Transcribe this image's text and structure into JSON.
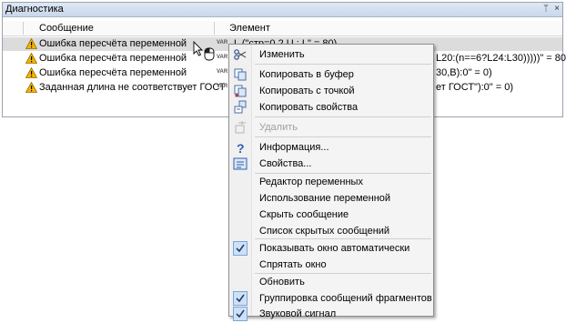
{
  "panel": {
    "title": "Диагностика",
    "pin_glyph": "ᛘ",
    "close_glyph": "×",
    "columns": {
      "message": "Сообщение",
      "element": "Элемент"
    }
  },
  "rows": [
    {
      "message": "Ошибка пересчёта переменной",
      "var_tag": "VAR",
      "element": "L (\"стр=0 2 U : L\" = 80)",
      "selected": true
    },
    {
      "message": "Ошибка пересчёта переменной",
      "var_tag": "VAR",
      "element": "L20:(n==6?L24:L30)))))\" = 80)",
      "selected": false
    },
    {
      "message": "Ошибка пересчёта переменной",
      "var_tag": "VAR",
      "element": "30,B):0\" = 0)",
      "selected": false
    },
    {
      "message": "Заданная длина не соответствует ГОСТ",
      "var_tag": "VAR",
      "element": "ет ГОСТ\"):0\" = 0)",
      "selected": false
    }
  ],
  "menu": {
    "items": [
      {
        "label": "Изменить",
        "icon": "scissors-edit-icon",
        "disabled": false
      },
      {
        "label": "Копировать в буфер",
        "icon": "copy-icon",
        "disabled": false
      },
      {
        "label": "Копировать с точкой",
        "icon": "copy-point-icon",
        "disabled": false
      },
      {
        "label": "Копировать свойства",
        "icon": "copy-properties-icon",
        "disabled": false
      },
      {
        "label": "Удалить",
        "icon": "delete-icon",
        "disabled": true
      },
      {
        "label": "Информация...",
        "icon": "question-icon",
        "disabled": false
      },
      {
        "label": "Свойства...",
        "icon": "properties-icon",
        "disabled": false
      },
      {
        "label": "Редактор переменных",
        "disabled": false
      },
      {
        "label": "Использование переменной",
        "disabled": false
      },
      {
        "label": "Скрыть сообщение",
        "disabled": false
      },
      {
        "label": "Список скрытых сообщений",
        "disabled": false
      },
      {
        "label": "Показывать окно автоматически",
        "checked": true
      },
      {
        "label": "Спрятать окно",
        "disabled": false
      },
      {
        "label": "Обновить",
        "disabled": false
      },
      {
        "label": "Группировка сообщений фрагментов",
        "checked": true
      },
      {
        "label": "Звуковой сигнал",
        "checked": true
      }
    ]
  },
  "colors": {
    "warning": "#f2b600",
    "accent": "#2f6fc9"
  }
}
